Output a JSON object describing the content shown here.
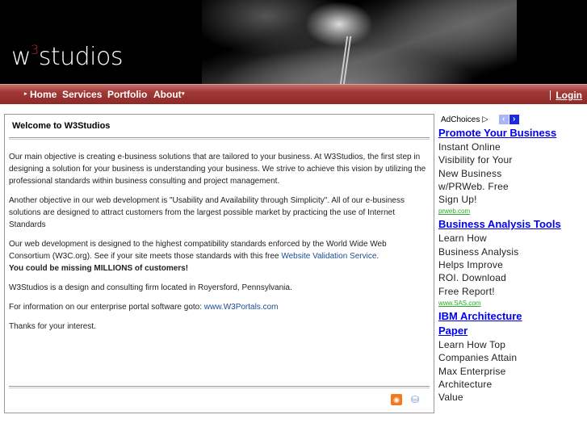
{
  "header": {
    "logo_prefix": "w",
    "logo_sup": "3",
    "logo_suffix": "studios"
  },
  "nav": {
    "items": [
      "Home",
      "Services",
      "Portfolio",
      "About"
    ],
    "login": "Login"
  },
  "main": {
    "title": "Welcome to W3Studios",
    "p1": "Our main objective is creating e-business solutions that are tailored to your business. At W3Studios, the first step in designing a solution for your business is understanding your business. We strive to achieve this vision by utilizing the professional standards within business consulting and project management.",
    "p2": "Another objective in our web development is \"Usability and Availability through Simplicity\". All of our e-business solutions are designed to attract customers from the largest possible market by practicing the use of Internet Standards",
    "p3": "Our web development is designed to the highest compatibility standards enforced by the World Wide Web Consortium (W3C.org). See if your site meets those standards with this free ",
    "p3_link": "Website Validation Service",
    "p3_end": ".",
    "p3_bold": "You could be missing MILLIONS of customers!",
    "p4": "W3Studios is a design and consulting firm located in Royersford, Pennsylvania.",
    "p5": "For information on our enterprise portal software goto: ",
    "p5_link": "www.W3Portals.com",
    "p6": "Thanks for your interest."
  },
  "ads": {
    "adchoices": "AdChoices",
    "items": [
      {
        "title": "Promote Your Business",
        "body": "Instant Online Visibility for Your New Business w/PRWeb. Free Sign Up!",
        "url": "prweb.com"
      },
      {
        "title": "Business Analysis Tools",
        "body": "Learn How Business Analysis Helps Improve ROI. Download Free Report!",
        "url": "www.SAS.com"
      },
      {
        "title": "IBM Architecture Paper",
        "body": "Learn How Top Companies Attain Max Enterprise Architecture Value",
        "url": ""
      }
    ]
  }
}
